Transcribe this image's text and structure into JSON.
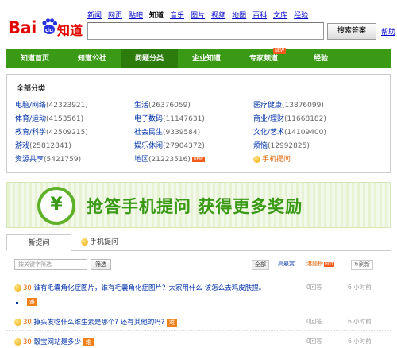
{
  "header": {
    "logo_text_bai": "Bai",
    "logo_text_zhidao": "知道",
    "nav": [
      "新闻",
      "网页",
      "贴吧",
      "知道",
      "音乐",
      "图片",
      "视频",
      "地图",
      "百科",
      "文库",
      "经验"
    ],
    "nav_active_index": 3,
    "search_value": "",
    "search_button": "搜索答案",
    "help": "帮助"
  },
  "main_nav": [
    {
      "label": "知道首页"
    },
    {
      "label": "知道公社"
    },
    {
      "label": "问题分类",
      "active": true
    },
    {
      "label": "企业知道"
    },
    {
      "label": "专家频道",
      "badge": "NEW"
    },
    {
      "label": "经验"
    }
  ],
  "categories": {
    "title": "全部分类",
    "items": [
      {
        "name": "电脑/网络",
        "count": "(42323921)"
      },
      {
        "name": "生活",
        "count": "(26376059)"
      },
      {
        "name": "医疗健康",
        "count": "(13876099)"
      },
      {
        "name": "体育/运动",
        "count": "(4153561)"
      },
      {
        "name": "电子数码",
        "count": "(11147631)"
      },
      {
        "name": "商业/理财",
        "count": "(11668182)"
      },
      {
        "name": "教育/科学",
        "count": "(42509215)"
      },
      {
        "name": "社会民生",
        "count": "(9339584)"
      },
      {
        "name": "文化/艺术",
        "count": "(14109400)"
      },
      {
        "name": "游戏",
        "count": "(25812841)"
      },
      {
        "name": "娱乐休闲",
        "count": "(27904372)"
      },
      {
        "name": "烦恼",
        "count": "(12992825)"
      },
      {
        "name": "资源共享",
        "count": "(5421759)"
      },
      {
        "name": "地区",
        "count": "(21223516)",
        "badge": "NEW"
      },
      {
        "name": "手机提问",
        "count": ""
      }
    ]
  },
  "banner": {
    "symbol": "¥",
    "text": "抢答手机提问  获得更多奖励"
  },
  "tabs": {
    "new": "新提问",
    "mobile": "手机提问"
  },
  "filter": {
    "placeholder": "按关键字筛选",
    "button": "筛选",
    "all": "全部",
    "high_reward": "高悬赏",
    "hot_rank": "港题榜",
    "hot_badge": "HOT",
    "refresh": "刷新"
  },
  "questions": [
    {
      "reward": "30",
      "title": "谁有毛囊角化症图片，谁有毛囊角化症图片？大家用什么 该怎么去鸡皮肤捏。",
      "tag": "难",
      "answers": "0回答",
      "time": "6 小时前"
    },
    {
      "reward": "30",
      "title": "掉头发吃什么维生素是哪个? 还有其他的吗?",
      "tag": "难",
      "answers": "0回答",
      "time": "6 小时前"
    },
    {
      "reward": "30",
      "title": "毂宝网站是多少",
      "tag": "难",
      "answers": "0回答",
      "time": "6 小时前"
    }
  ]
}
